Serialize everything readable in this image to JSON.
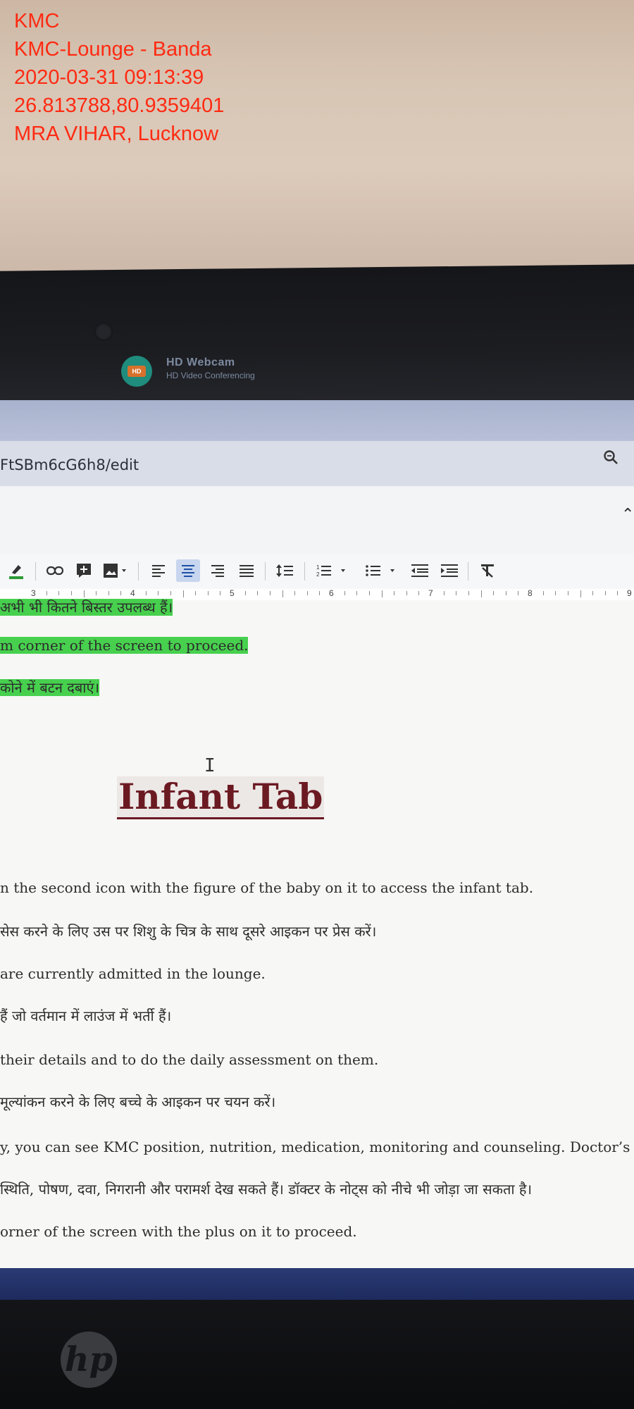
{
  "photo_stamp": {
    "line1": "KMC",
    "line2": "KMC-Lounge - Banda",
    "line3": "2020-03-31 09:13:39",
    "line4": "26.813788,80.9359401",
    "line5": "MRA VIHAR, Lucknow",
    "color": "#ff2a12"
  },
  "webcam": {
    "badge": "HD",
    "title": "HD Webcam",
    "subtitle": "HD Video Conferencing"
  },
  "browser": {
    "url_fragment": "FtSBm6cG6h8/edit",
    "zoom_icon": "magnifier-icon",
    "collapse_icon": "chevron-up-icon"
  },
  "toolbar": {
    "buttons": [
      "highlight-pen-icon",
      "link-icon",
      "insert-comment-icon",
      "insert-image-icon",
      "align-left-icon",
      "align-center-icon",
      "align-right-icon",
      "align-justify-icon",
      "line-spacing-icon",
      "numbered-list-icon",
      "bulleted-list-icon",
      "decrease-indent-icon",
      "increase-indent-icon",
      "clear-formatting-icon"
    ],
    "active": "align-center-icon"
  },
  "ruler": {
    "numbers": [
      "3",
      "4",
      "5",
      "6",
      "7",
      "8",
      "9"
    ]
  },
  "document": {
    "line_top_partial": "अभी भी कितने बिस्तर उपलब्ध हैं।",
    "line_corner": "m corner of the screen to proceed.",
    "line_corner_hindi": "कोने में बटन दबाएं।",
    "heading": "Infant Tab",
    "paragraphs": [
      "n the second icon with the figure of the baby on it to access the infant tab.",
      "सेस करने के लिए उस पर शिशु के चित्र के साथ दूसरे आइकन पर प्रेस करें।",
      "are currently admitted in the lounge.",
      "हैं जो वर्तमान में लाउंज में भर्ती हैं।",
      "their details and to do the daily assessment on them.",
      "मूल्यांकन करने के लिए बच्चे के आइकन पर चयन करें।",
      "y, you can see KMC position, nutrition, medication, monitoring and counseling. Doctor’s n",
      "स्थिति, पोषण, दवा, निगरानी और परामर्श देख सकते हैं। डॉक्टर के नोट्स को नीचे भी जोड़ा जा सकता है।",
      "orner of the screen with the plus on it to proceed."
    ],
    "highlight_color": "#47d04e",
    "heading_color": "#6b1a22"
  },
  "laptop": {
    "logo": "hp"
  }
}
